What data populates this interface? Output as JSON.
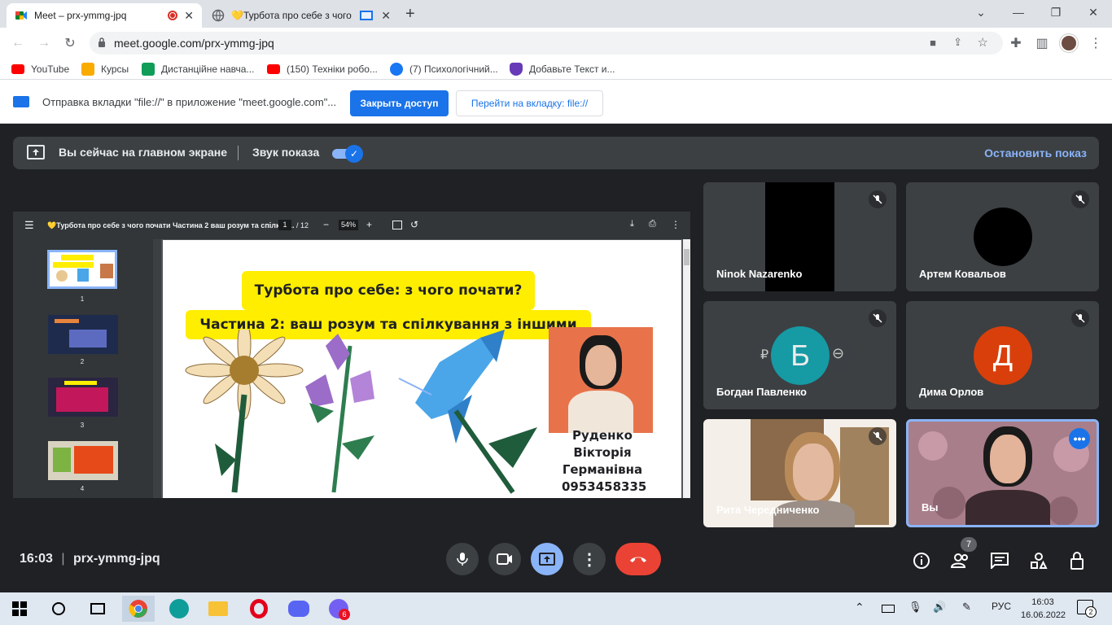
{
  "tabs": [
    {
      "title": "Meet – prx-ymmg-jpq",
      "active": true
    },
    {
      "title": "💛Турбота про себе з чого",
      "active": false
    }
  ],
  "address": {
    "url": "meet.google.com/prx-ymmg-jpq"
  },
  "bookmarks": [
    {
      "label": "YouTube",
      "icon": "youtube-icon"
    },
    {
      "label": "Курсы",
      "icon": "classroom-icon"
    },
    {
      "label": "Дистанційне навча...",
      "icon": "sheets-icon"
    },
    {
      "label": "(150) Техніки робо...",
      "icon": "youtube-icon"
    },
    {
      "label": "(7) Психологічний...",
      "icon": "facebook-icon"
    },
    {
      "label": "Добавьте Текст и...",
      "icon": "shield-icon"
    }
  ],
  "infobar": {
    "message": "Отправка вкладки \"file://\" в приложение \"meet.google.com\"...",
    "close_access": "Закрыть доступ",
    "go_to_tab": "Перейти на вкладку: file://"
  },
  "banner": {
    "main_screen": "Вы сейчас на главном экране",
    "share_audio": "Звук показа",
    "stop": "Остановить показ"
  },
  "pdf": {
    "title": "💛Турбота про себе з чого почати Частина 2 ваш розум та спілкув...",
    "page": "1",
    "pages": "/ 12",
    "zoom": "54%",
    "thumb_numbers": [
      "1",
      "2",
      "3",
      "4"
    ],
    "slide": {
      "title1": "Турбота про себе: з чого почати?",
      "title2": "Частина 2: ваш розум та спілкування з іншими",
      "author": [
        "Руденко",
        "Вікторія",
        "Германівна",
        "0953458335"
      ]
    }
  },
  "participants": [
    {
      "name": "Ninok Nazarenko",
      "muted": true
    },
    {
      "name": "Артем Ковальов",
      "muted": true
    },
    {
      "name": "Богдан Павленко",
      "muted": true,
      "initial": "Б",
      "color": "#12a4af"
    },
    {
      "name": "Дима Орлов",
      "muted": true,
      "initial": "Д",
      "color": "#d93f0b"
    },
    {
      "name": "Рита Чередниченко",
      "muted": true
    },
    {
      "name": "Вы",
      "muted": false
    }
  ],
  "meeting": {
    "time": "16:03",
    "separator": "|",
    "code": "prx-ymmg-jpq",
    "people_count": "7"
  },
  "taskbar": {
    "lang": "РУС",
    "time": "16:03",
    "date": "16.06.2022",
    "viber_badge": "6",
    "notif_badge": "2"
  }
}
